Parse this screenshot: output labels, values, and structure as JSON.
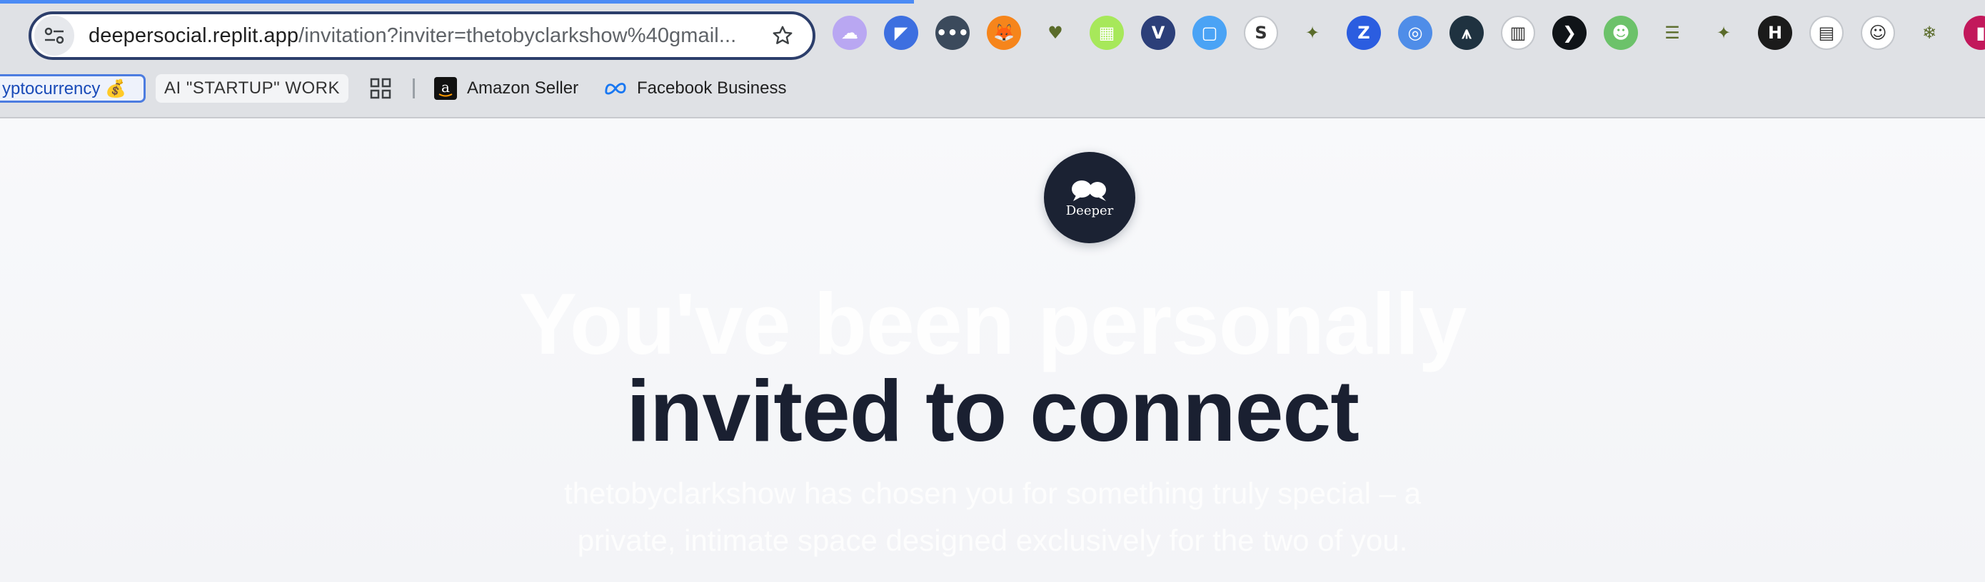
{
  "browser": {
    "url_domain": "deepersocial.replit.app",
    "url_path": "/invitation?inviter=thetobyclarkshow%40gmail...",
    "extensions": [
      {
        "name": "ghost-extension-icon",
        "bg": "#b9a7f2",
        "glyph": "☁"
      },
      {
        "name": "sail-extension-icon",
        "bg": "#3d6fe0",
        "glyph": "◤"
      },
      {
        "name": "dots-extension-icon",
        "bg": "#3b4a5c",
        "glyph": "•••"
      },
      {
        "name": "metamask-fox-icon",
        "bg": "#f6851b",
        "glyph": "🦊"
      },
      {
        "name": "heart-extension-icon",
        "bg": "#dfe1e5",
        "glyph": "♥"
      },
      {
        "name": "grid-extension-icon",
        "bg": "#a7e85a",
        "glyph": "▦"
      },
      {
        "name": "v-extension-icon",
        "bg": "#2c3f79",
        "glyph": "V"
      },
      {
        "name": "note-extension-icon",
        "bg": "#4aa3f5",
        "glyph": "▢"
      },
      {
        "name": "s-extension-icon",
        "bg": "#ffffff",
        "glyph": "S"
      },
      {
        "name": "dino-extension-icon",
        "bg": "#dfe1e5",
        "glyph": "✦"
      },
      {
        "name": "z-extension-icon",
        "bg": "#2b5de0",
        "glyph": "Z"
      },
      {
        "name": "circle-wave-icon",
        "bg": "#4f8de8",
        "glyph": "◎"
      },
      {
        "name": "compass-extension-icon",
        "bg": "#1f3240",
        "glyph": "⩚"
      },
      {
        "name": "barcode-extension-icon",
        "bg": "#ffffff",
        "glyph": "▥"
      },
      {
        "name": "arrow-extension-icon",
        "bg": "#101418",
        "glyph": "❯"
      },
      {
        "name": "frog-extension-icon",
        "bg": "#6cc26a",
        "glyph": "☻"
      },
      {
        "name": "layers-extension-icon",
        "bg": "#dfe1e5",
        "glyph": "☰"
      },
      {
        "name": "dino-green-icon",
        "bg": "#dfe1e5",
        "glyph": "✦"
      },
      {
        "name": "h-extension-icon",
        "bg": "#1b1b1b",
        "glyph": "H"
      },
      {
        "name": "flag-extension-icon",
        "bg": "#ffffff",
        "glyph": "▤"
      },
      {
        "name": "face-outline-icon",
        "bg": "#ffffff",
        "glyph": "☺"
      },
      {
        "name": "snowflake-extension-icon",
        "bg": "#dfe1e5",
        "glyph": "❄"
      },
      {
        "name": "pink-extension-icon",
        "bg": "#c2185b",
        "glyph": "▮"
      }
    ]
  },
  "bookmarks": {
    "crypto": "yptocurrency 💰",
    "ai": "AI \"STARTUP\" WORK",
    "amazon": "Amazon Seller",
    "facebook": "Facebook Business"
  },
  "page": {
    "logo_text": "Deeper",
    "headline_line1": "You've been personally",
    "headline_line2": "invited to connect",
    "subtitle_line1": "thetobyclarkshow has chosen you for something truly special – a",
    "subtitle_line2": "private, intimate space designed exclusively for the two of you."
  },
  "colors": {
    "accent": "#4c8bf5",
    "headline": "#1a2031",
    "logo_bg": "#1b2233"
  }
}
